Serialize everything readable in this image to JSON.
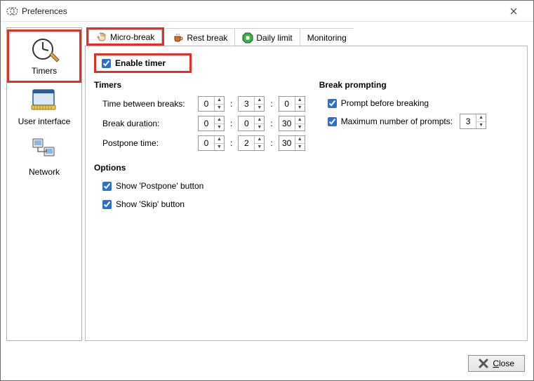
{
  "window": {
    "title": "Preferences"
  },
  "sidebar": {
    "items": [
      {
        "label": "Timers"
      },
      {
        "label": "User interface"
      },
      {
        "label": "Network"
      }
    ]
  },
  "tabs": [
    {
      "label": "Micro-break",
      "icon": "hand-icon"
    },
    {
      "label": "Rest break",
      "icon": "coffee-icon"
    },
    {
      "label": "Daily limit",
      "icon": "stop-icon"
    },
    {
      "label": "Monitoring",
      "icon": null
    }
  ],
  "enable": {
    "label": "Enable timer",
    "checked": true
  },
  "timers": {
    "title": "Timers",
    "rows": [
      {
        "label": "Time between breaks:",
        "h": "0",
        "m": "3",
        "s": "0"
      },
      {
        "label": "Break duration:",
        "h": "0",
        "m": "0",
        "s": "30"
      },
      {
        "label": "Postpone time:",
        "h": "0",
        "m": "2",
        "s": "30"
      }
    ]
  },
  "prompting": {
    "title": "Break prompting",
    "prompt_before": {
      "label": "Prompt before breaking",
      "checked": true
    },
    "max_prompts": {
      "label": "Maximum number of prompts:",
      "checked": true,
      "value": "3"
    }
  },
  "options": {
    "title": "Options",
    "show_postpone": {
      "label": "Show 'Postpone' button",
      "checked": true
    },
    "show_skip": {
      "label": "Show 'Skip' button",
      "checked": true
    }
  },
  "footer": {
    "close_label": "Close"
  }
}
